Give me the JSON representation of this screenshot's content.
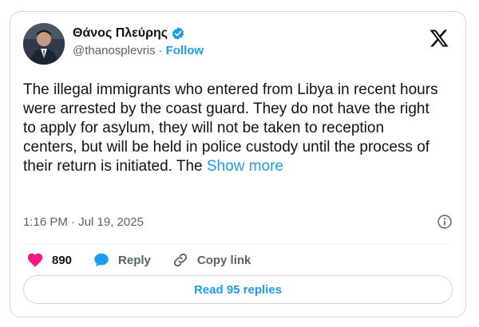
{
  "author": {
    "display_name": "Θάνος Πλεύρης",
    "handle": "@thanosplevris",
    "separator": "·",
    "follow_label": "Follow",
    "verified": true
  },
  "tweet": {
    "text": "The illegal immigrants who entered from Libya in recent hours were arrested by the coast guard. They do not have the right to apply for asylum, they will not be taken to reception centers, but will be held in police custody until the process of their return is initiated. The ",
    "show_more_label": "Show more",
    "timestamp": "1:16 PM · Jul 19, 2025"
  },
  "actions": {
    "like_count": "890",
    "reply_label": "Reply",
    "copy_link_label": "Copy link"
  },
  "read_replies_label": "Read 95 replies",
  "colors": {
    "accent": "#1d9bf0",
    "like": "#f91880",
    "text": "#0f1419",
    "muted": "#536471",
    "border": "#cfd9de"
  },
  "icons": {
    "brand": "x-logo-icon",
    "verified": "verified-badge-icon",
    "info": "info-icon",
    "like": "heart-icon",
    "reply": "speech-bubble-icon",
    "copy_link": "link-icon"
  }
}
